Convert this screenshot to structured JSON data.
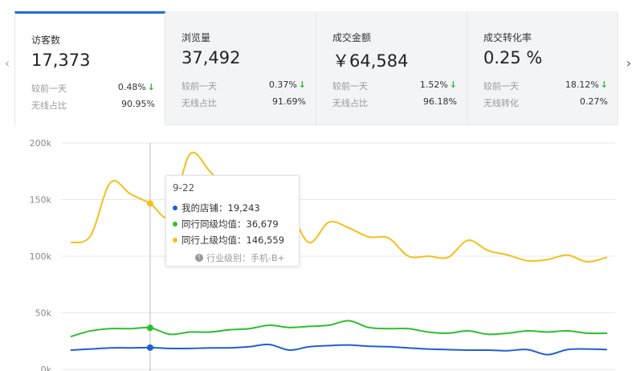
{
  "nav": {
    "prev_glyph": "‹",
    "next_glyph": "›"
  },
  "metrics": [
    {
      "title": "访客数",
      "value": "17,373",
      "row1_label": "较前一天",
      "row1_value": "0.48%",
      "row1_trend": "down",
      "row2_label": "无线占比",
      "row2_value": "90.95%",
      "active": true
    },
    {
      "title": "浏览量",
      "value": "37,492",
      "row1_label": "较前一天",
      "row1_value": "0.37%",
      "row1_trend": "down",
      "row2_label": "无线占比",
      "row2_value": "91.69%",
      "active": false
    },
    {
      "title": "成交金额",
      "value": "￥64,584",
      "row1_label": "较前一天",
      "row1_value": "1.52%",
      "row1_trend": "down",
      "row2_label": "无线占比",
      "row2_value": "96.18%",
      "active": false
    },
    {
      "title": "成交转化率",
      "value": "0.25 %",
      "row1_label": "较前一天",
      "row1_value": "18.12%",
      "row1_trend": "down",
      "row2_label": "无线转化",
      "row2_value": "0.27%",
      "active": false
    }
  ],
  "trend_down_glyph": "↓",
  "tooltip": {
    "date": "9-22",
    "rows": [
      {
        "label": "我的店铺：19,243",
        "color": "#1f5fd6"
      },
      {
        "label": "同行同级均值：36,679",
        "color": "#2cbf2c"
      },
      {
        "label": "同行上级均值：146,559",
        "color": "#f5c01a"
      }
    ],
    "footer_icon": "info-icon",
    "footer": "行业级别：手机-B+"
  },
  "colors": {
    "accent": "#1f6fd4",
    "down": "#2eb82e"
  },
  "chart_data": {
    "type": "line",
    "y_ticks": [
      "200k",
      "150k",
      "100k",
      "50k",
      "0k"
    ],
    "ylim": [
      0,
      200000
    ],
    "grid": true,
    "series": [
      {
        "name": "同行上级均值",
        "color": "#f5c01a",
        "values": [
          112000,
          118000,
          165000,
          155000,
          146559,
          136000,
          190000,
          175000,
          155000,
          150000,
          147000,
          140000,
          112000,
          130000,
          125000,
          117000,
          116000,
          100000,
          100000,
          99000,
          114000,
          105000,
          101000,
          96000,
          97000,
          101000,
          95000,
          99000
        ]
      },
      {
        "name": "同行同级均值",
        "color": "#2cbf2c",
        "values": [
          29000,
          34000,
          36000,
          36000,
          36679,
          31000,
          33000,
          33000,
          35000,
          36000,
          39000,
          37000,
          38000,
          39000,
          43000,
          37000,
          36000,
          36000,
          33000,
          32000,
          34000,
          31000,
          32000,
          34000,
          33000,
          34000,
          32000,
          32000
        ]
      },
      {
        "name": "我的店铺",
        "color": "#1f5fd6",
        "values": [
          17000,
          18000,
          19000,
          19000,
          19243,
          18500,
          18500,
          19000,
          19000,
          20000,
          22000,
          17000,
          20000,
          21000,
          21500,
          20500,
          20000,
          19000,
          18000,
          17500,
          17000,
          17000,
          16500,
          17500,
          13000,
          17500,
          18000,
          17500
        ]
      }
    ],
    "highlight_index": 4
  }
}
